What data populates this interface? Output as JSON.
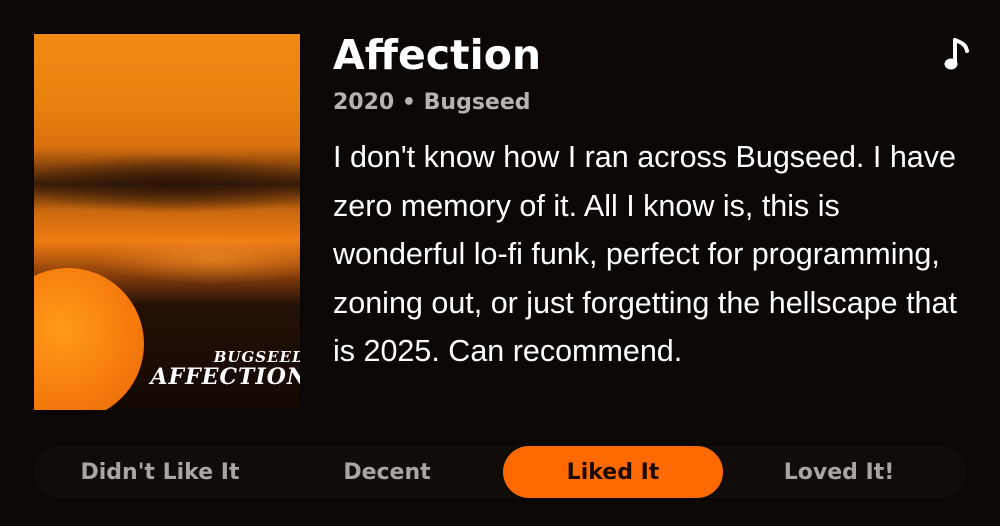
{
  "album": {
    "title": "Affection",
    "year": "2020",
    "artist": "Bugseed",
    "meta_separator": "•",
    "cover_artist_text": "BUGSEED",
    "cover_title_text": "AFFECTION",
    "review": "I don't know how I ran across Bugseed. I have zero memory of it. All I know is, this is wonderful lo-fi funk, perfect for programming, zoning out, or just forgetting the hellscape that is 2025. Can recommend."
  },
  "icons": {
    "media_type": "music-note-icon"
  },
  "rating": {
    "options": [
      {
        "label": "Didn't Like It",
        "selected": false
      },
      {
        "label": "Decent",
        "selected": false
      },
      {
        "label": "Liked It",
        "selected": true
      },
      {
        "label": "Loved It!",
        "selected": false
      }
    ]
  },
  "colors": {
    "accent": "#ff6a00",
    "background": "#0b0705",
    "muted_text": "#b7b3b0"
  }
}
